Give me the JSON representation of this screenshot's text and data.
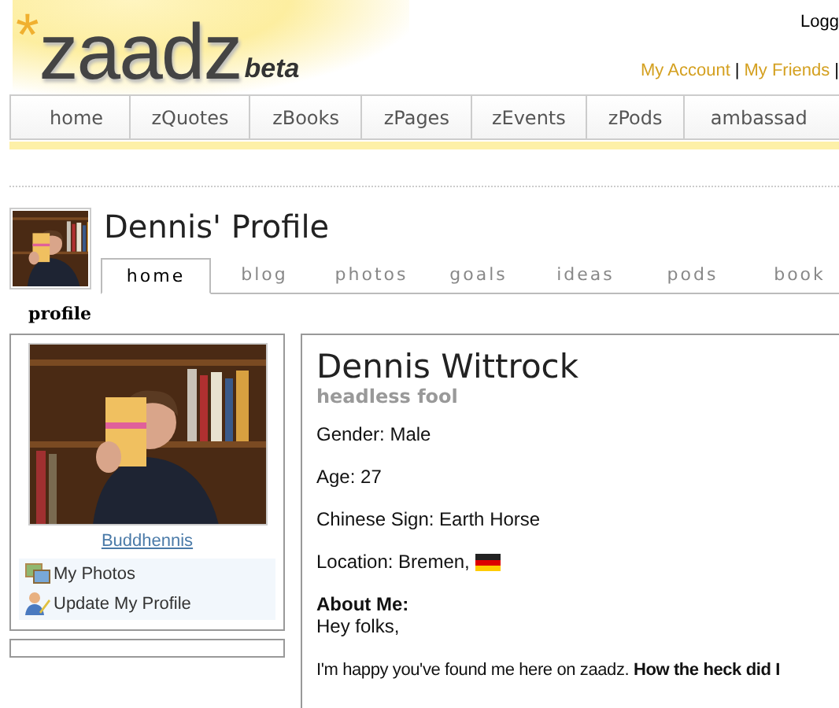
{
  "header": {
    "logo": {
      "mark": "*",
      "name": "zaadz",
      "badge": "beta"
    },
    "top_link": "Logg",
    "account_links": [
      {
        "label": "My Account"
      },
      {
        "label": "My Friends"
      }
    ],
    "link_separator": "|"
  },
  "nav": [
    "home",
    "zQuotes",
    "zBooks",
    "zPages",
    "zEvents",
    "zPods",
    "ambassad"
  ],
  "profile": {
    "title": "Dennis' Profile",
    "tabs": [
      {
        "label": "home",
        "selected": true
      },
      {
        "label": "blog",
        "selected": false
      },
      {
        "label": "photos",
        "selected": false
      },
      {
        "label": "goals",
        "selected": false
      },
      {
        "label": "ideas",
        "selected": false
      },
      {
        "label": "pods",
        "selected": false
      },
      {
        "label": "book",
        "selected": false
      }
    ]
  },
  "section_label": "profile",
  "sidebar": {
    "username": "Buddhennis",
    "menu": [
      {
        "label": "My Photos",
        "kind": "photos"
      },
      {
        "label": "Update My Profile",
        "kind": "person"
      }
    ]
  },
  "main": {
    "name": "Dennis Wittrock",
    "tagline": "headless fool",
    "fields": [
      "Gender: Male",
      "Age: 27",
      "Chinese Sign: Earth Horse"
    ],
    "location": "Location: Bremen,",
    "about_label": "About Me:",
    "about_lines": [
      "Hey folks,",
      "I'm happy you've found me here on zaadz. **How the heck did I**"
    ]
  }
}
